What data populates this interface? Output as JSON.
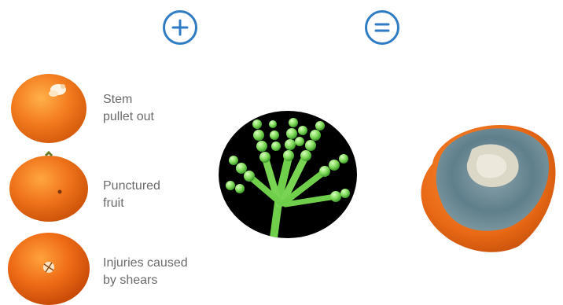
{
  "operators": [
    {
      "name": "plus",
      "color": "#2f7cc5"
    },
    {
      "name": "equals",
      "color": "#2f7cc5"
    }
  ],
  "causes": [
    {
      "line1": "Stem",
      "line2": "pullet out",
      "image": "orange-stem-pulled-icon"
    },
    {
      "line1": "Punctured",
      "line2": "fruit",
      "image": "orange-punctured-icon"
    },
    {
      "line1": "Injuries caused",
      "line2": "by shears",
      "image": "orange-shear-injury-icon"
    }
  ],
  "agent": {
    "image": "penicillium-mold-micrograph-icon"
  },
  "result": {
    "image": "moldy-orange-icon"
  },
  "colors": {
    "accent": "#2f7cc5",
    "text": "#6b6b6b",
    "orange": "#f07a1e",
    "mold_green": "#7ed957",
    "mold_gray": "#6f8a96"
  }
}
